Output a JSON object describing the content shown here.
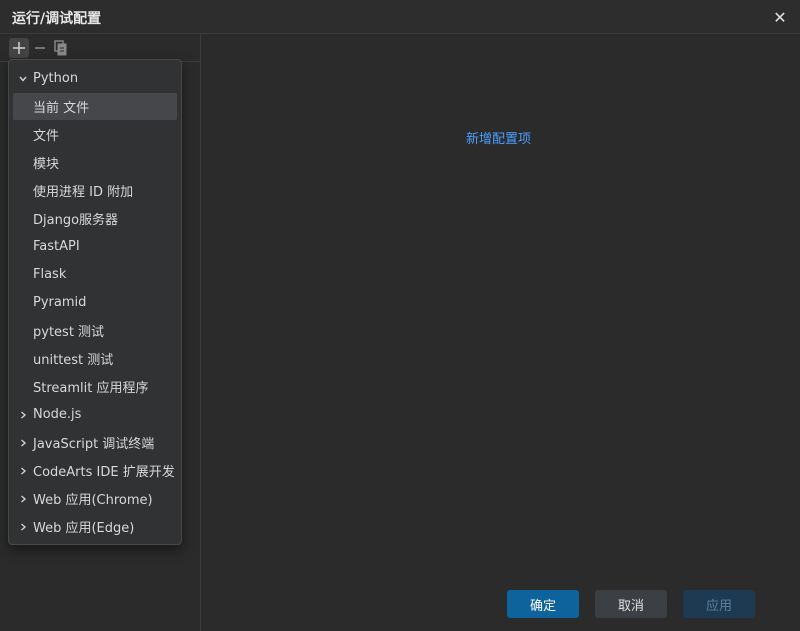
{
  "window": {
    "title": "运行/调试配置",
    "close_symbol": "✕"
  },
  "toolbar": {
    "add_icon": "plus-icon",
    "remove_icon": "minus-icon",
    "copy_icon": "copy-icon"
  },
  "main": {
    "add_config_link": "新增配置项"
  },
  "dropdown": {
    "groups": [
      {
        "label": "Python",
        "expanded": true,
        "children": [
          "当前 文件",
          "文件",
          "模块",
          "使用进程 ID 附加",
          "Django服务器",
          "FastAPI",
          "Flask",
          "Pyramid",
          "pytest 测试",
          "unittest 测试",
          "Streamlit 应用程序"
        ],
        "selected_child": "当前 文件"
      },
      {
        "label": "Node.js",
        "expanded": false
      },
      {
        "label": "JavaScript 调试终端",
        "expanded": false
      },
      {
        "label": "CodeArts IDE 扩展开发",
        "expanded": false
      },
      {
        "label": "Web 应用(Chrome)",
        "expanded": false
      },
      {
        "label": "Web 应用(Edge)",
        "expanded": false
      }
    ]
  },
  "footer": {
    "ok_label": "确定",
    "cancel_label": "取消",
    "apply_label": "应用"
  },
  "colors": {
    "accent": "#0e639c",
    "link": "#4a9eff"
  }
}
